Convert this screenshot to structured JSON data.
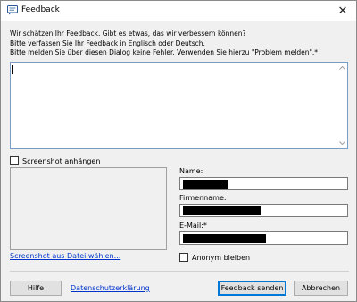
{
  "window": {
    "title": "Feedback",
    "close_symbol": "✕"
  },
  "intro": {
    "line1": "Wir schätzen Ihr Feedback. Gibt es etwas, das wir verbessern können?",
    "line2": "Bitte verfassen Sie Ihr Feedback in Englisch oder Deutsch.",
    "line3": "Bitte melden Sie über diesen Dialog keine Fehler. Verwenden Sie hierzu \"Problem melden\".*"
  },
  "feedback": {
    "value": ""
  },
  "screenshot": {
    "attach_label": "Screenshot anhängen",
    "attach_checked": false,
    "from_file_link": "Screenshot aus Datei wählen..."
  },
  "fields": {
    "name_label": "Name:",
    "company_label": "Firmenname:",
    "email_label": "E-Mail:*",
    "name_redacted": true,
    "company_redacted": true,
    "email_redacted": true
  },
  "anonymous": {
    "label": "Anonym bleiben",
    "checked": false
  },
  "footer": {
    "help_label": "Hilfe",
    "privacy_link": "Datenschutzerklärung",
    "send_label": "Feedback senden",
    "cancel_label": "Abbrechen"
  },
  "icons": {
    "app": "feedback-app-icon",
    "close": "close-icon",
    "scroll_up": "scroll-up-arrow-icon",
    "scroll_down": "scroll-down-arrow-icon"
  }
}
